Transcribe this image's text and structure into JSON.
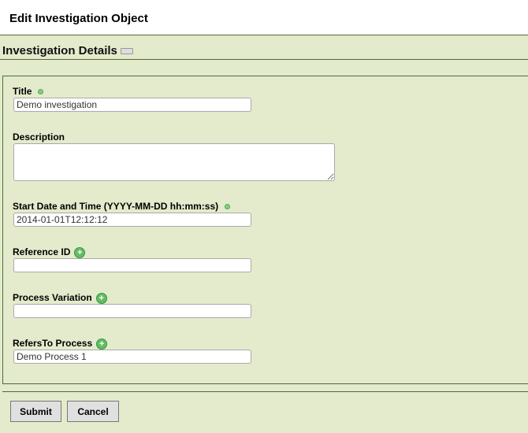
{
  "page_title": "Edit Investigation Object",
  "section_title": "Investigation Details",
  "fields": [
    {
      "label": "Title",
      "value": "Demo investigation",
      "marker": "required-dot"
    },
    {
      "label": "Description",
      "value": ""
    },
    {
      "label": "Start Date and Time (YYYY-MM-DD hh:mm:ss)",
      "value": "2014-01-01T12:12:12",
      "marker": "required-dot"
    },
    {
      "label": "Reference ID",
      "value": "",
      "marker": "add-icon"
    },
    {
      "label": "Process Variation",
      "value": "",
      "marker": "add-icon"
    },
    {
      "label": "RefersTo Process",
      "value": "Demo Process 1",
      "marker": "add-icon"
    }
  ],
  "buttons": {
    "submit": "Submit",
    "cancel": "Cancel"
  }
}
